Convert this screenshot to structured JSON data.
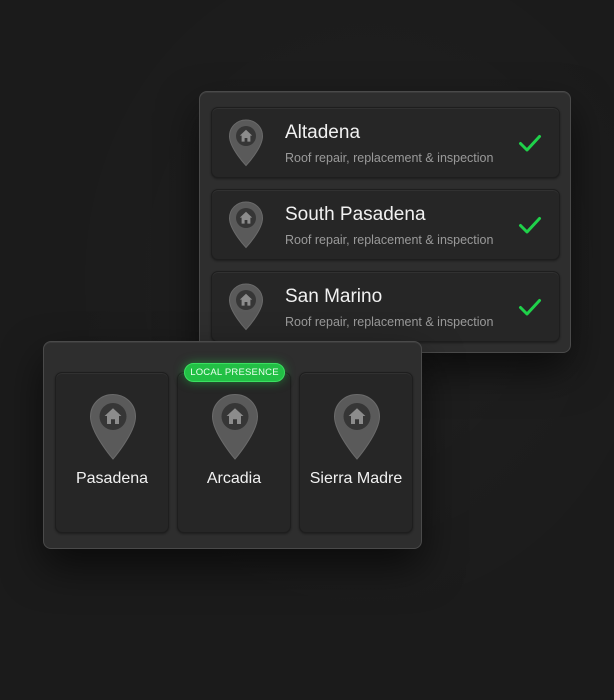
{
  "colors": {
    "accent_green": "#22c045",
    "checkmark_green": "#1fd14a",
    "pin_fill": "#5a5a5a",
    "pin_center": "#3a3a3a"
  },
  "service_areas": [
    {
      "city": "Altadena",
      "description": "Roof repair, replacement & inspection",
      "checked": true,
      "icon": "map-pin-home-icon"
    },
    {
      "city": "South Pasadena",
      "description": "Roof repair, replacement & inspection",
      "checked": true,
      "icon": "map-pin-home-icon"
    },
    {
      "city": "San Marino",
      "description": "Roof repair, replacement & inspection",
      "checked": true,
      "icon": "map-pin-home-icon"
    }
  ],
  "locations": [
    {
      "city": "Pasadena",
      "icon": "map-pin-home-icon"
    },
    {
      "city": "Arcadia",
      "icon": "map-pin-home-icon"
    },
    {
      "city": "Sierra Madre",
      "icon": "map-pin-home-icon"
    }
  ],
  "badge": {
    "label": "LOCAL PRESENCE"
  }
}
